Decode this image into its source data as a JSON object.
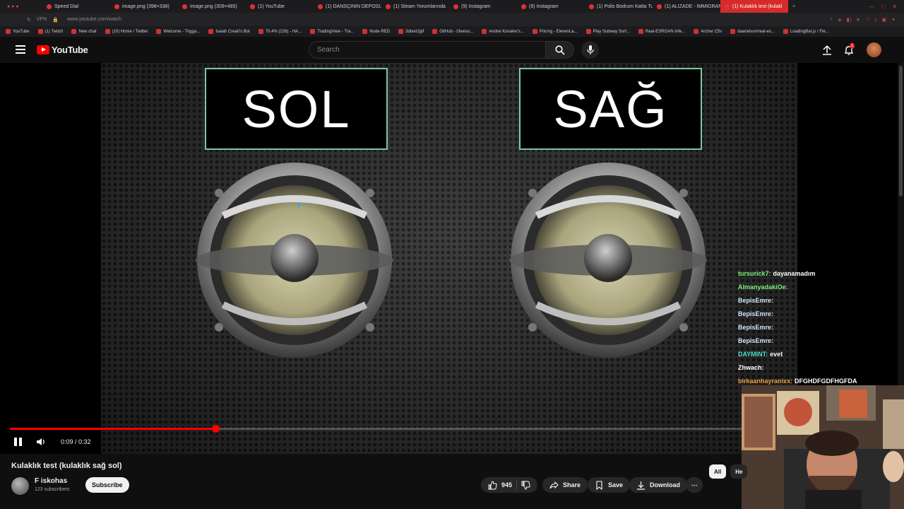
{
  "browser": {
    "tabs": [
      {
        "label": "Speed Dial"
      },
      {
        "label": "image.png (398×338)"
      },
      {
        "label": "image.png (309×485)"
      },
      {
        "label": "(1) YouTube"
      },
      {
        "label": "(1) DANSÇININ DEPOSUN"
      },
      {
        "label": "(1) Steam Yorumlarında"
      },
      {
        "label": "(9) Instagram"
      },
      {
        "label": "(9) Instagram"
      },
      {
        "label": "(1) Polis Bodrum Katta Tut"
      },
      {
        "label": "(1) ALIZADE - IMMIGRANT"
      },
      {
        "label": "(1) Kulaklık test (kulakl"
      }
    ],
    "url": "www.youtube.com/watch",
    "bookmarks": [
      "YouTube",
      "(1) Twitch",
      "New chat",
      "(10) Home / Twitter",
      "Welcome - Trigga...",
      "Isaiah Creati's Bot",
      "70.4% (226) - HA...",
      "TradingView - Tra...",
      "Node-RED",
      "3dtext2gif",
      "GitHub - t3weso...",
      "Andrei Kovalev's...",
      "Pricing - ElevenLa...",
      "Play Subway Surf...",
      "Real-ESRGAN Infe...",
      "Archer C5v",
      "daanelson/real-es...",
      "LoadingBar.js / Fle..."
    ]
  },
  "header": {
    "logo_text": "YouTube",
    "search_placeholder": "Search",
    "notification_count": "1"
  },
  "video": {
    "left_label": "SOL",
    "right_label": "SAĞ",
    "time_display": "0:09 / 0:32",
    "progress_fraction": 0.28125
  },
  "chat": [
    {
      "user": "tursurick7:",
      "msg": "dayanamadım",
      "color": "#7ef07e"
    },
    {
      "user": "AlmanyadakiOe:",
      "msg": "",
      "color": "#7ef07e"
    },
    {
      "user": "BepisEmre:",
      "msg": "",
      "color": "#cfe6ff"
    },
    {
      "user": "BepisEmre:",
      "msg": "",
      "color": "#cfe6ff"
    },
    {
      "user": "BepisEmre:",
      "msg": "",
      "color": "#cfe6ff"
    },
    {
      "user": "BepisEmre:",
      "msg": "",
      "color": "#cfe6ff"
    },
    {
      "user": "DAYMINT:",
      "msg": "evet",
      "color": "#4fe0d0"
    },
    {
      "user": "Zhwach:",
      "msg": "",
      "color": "#ffffff"
    },
    {
      "user": "birkaanhayranixx:",
      "msg": "DFGHDFGDFHGFDA",
      "color": "#f0a040"
    }
  ],
  "meta": {
    "title": "Kulaklık test (kulaklık sağ sol)",
    "channel": "F iskohas",
    "subscribers": "123 subscribers",
    "subscribe_label": "Subscribe",
    "likes": "945",
    "share_label": "Share",
    "save_label": "Save",
    "download_label": "Download",
    "chip_all": "All",
    "chip_next": "He"
  }
}
